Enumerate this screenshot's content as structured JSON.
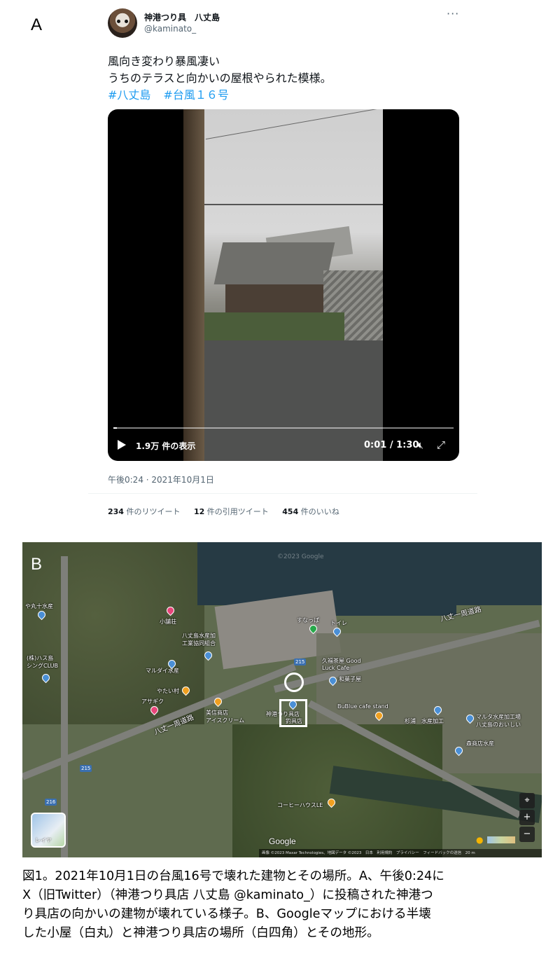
{
  "panel_a_label": "A",
  "panel_b_label": "B",
  "tweet": {
    "name": "神港つり具　八丈島",
    "handle": "@kaminato_",
    "more_icon": "ellipsis-icon",
    "text_line1": "風向き変わり暴風凄い",
    "text_line2": "うちのテラスと向かいの屋根やられた模様。",
    "hashtags": [
      "#八丈島",
      "#台風１６号"
    ],
    "video": {
      "views": "1.9万 件の表示",
      "time": "0:01 / 1:30",
      "progress": 0.011
    },
    "date": "午後0:24 · 2021年10月1日",
    "stats": [
      {
        "count": "234",
        "label": "件のリツイート"
      },
      {
        "count": "12",
        "label": "件の引用ツイート"
      },
      {
        "count": "454",
        "label": "件のいいね"
      }
    ]
  },
  "map": {
    "watermark": "©2023 Google",
    "labels": {
      "l1": "や丸十水産",
      "l2": "(株)ハス島\nシングCLUB",
      "l3": "八丈島水産加\n工業協同組合",
      "l4": "マルダイ水産",
      "l5": "やたい村",
      "l6": "アサギク",
      "l7": "美信商店\nアイスクリーム",
      "l8": "八丈一周道路",
      "l9": "八丈一周道路",
      "l10": "すなっぱ",
      "l11": "トイレ",
      "l12": "久福茶屋 Good\nLuck Cafe",
      "l13": "和菓子屋",
      "l14": "BuBlue cafe stand",
      "l15": "杉浦　水産加工",
      "l16": "マルタ水産加工場\n八丈島のおいしい",
      "l17": "森商店水産",
      "l18": "神港つり具店",
      "l19": "釣具店",
      "l20": "コーヒーハウスLE",
      "l21": "小舗荘"
    },
    "routes": [
      "215",
      "215",
      "216"
    ],
    "layers_label": "レイヤ",
    "google_logo": "Google",
    "attribution": "画像 ©2023 Maxar Technologies、地図データ ©2023　日本　利用規約　プライバシー　フィードバックの送信　20 m"
  },
  "caption": {
    "line1": "図1。2021年10月1日の台風16号で壊れた建物とその場所。A、午後0:24に",
    "line2": "X（旧Twitter）（神港つり具店 八丈島 @kaminato_）に投稿された神港つ",
    "line3": "り具店の向かいの建物が壊れている様子。B、Googleマップにおける半壊",
    "line4": "した小屋（白丸）と神港つり具店の場所（白四角）とその地形。"
  }
}
